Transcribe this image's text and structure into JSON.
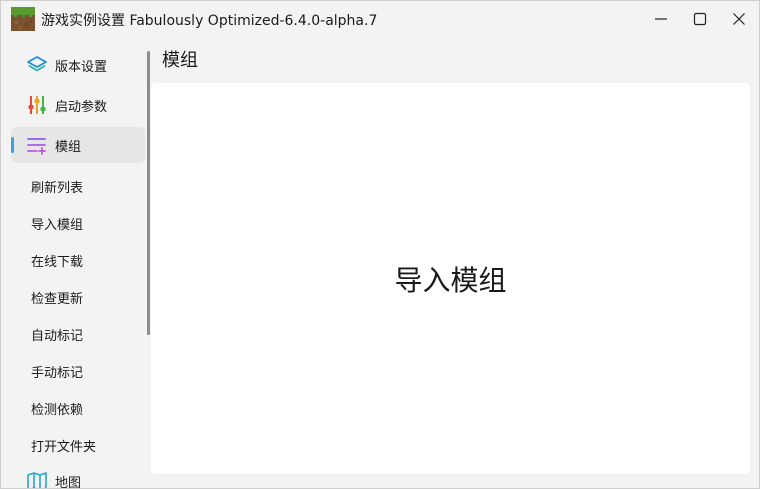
{
  "window": {
    "title": "游戏实例设置 Fabulously Optimized-6.4.0-alpha.7",
    "app_icon": "minecraft-grass-block-icon",
    "controls": [
      "minimize-icon",
      "maximize-icon",
      "close-icon"
    ]
  },
  "sidebar": {
    "items": [
      {
        "label": "版本设置",
        "icon": "layers-icon"
      },
      {
        "label": "启动参数",
        "icon": "sliders-icon"
      },
      {
        "label": "模组",
        "icon": "list-add-icon",
        "active": true
      }
    ],
    "sub_items": [
      "刷新列表",
      "导入模组",
      "在线下载",
      "检查更新",
      "自动标记",
      "手动标记",
      "检测依赖",
      "打开文件夹"
    ],
    "bottom_item": {
      "label": "地图",
      "icon": "map-icon"
    }
  },
  "main": {
    "title": "模组",
    "empty_action": "导入模组"
  },
  "colors": {
    "active_indicator": "#3aa6d6",
    "window_bg": "#f3f3f3",
    "content_bg": "#ffffff",
    "nav_active_bg": "#e6e6e6"
  }
}
